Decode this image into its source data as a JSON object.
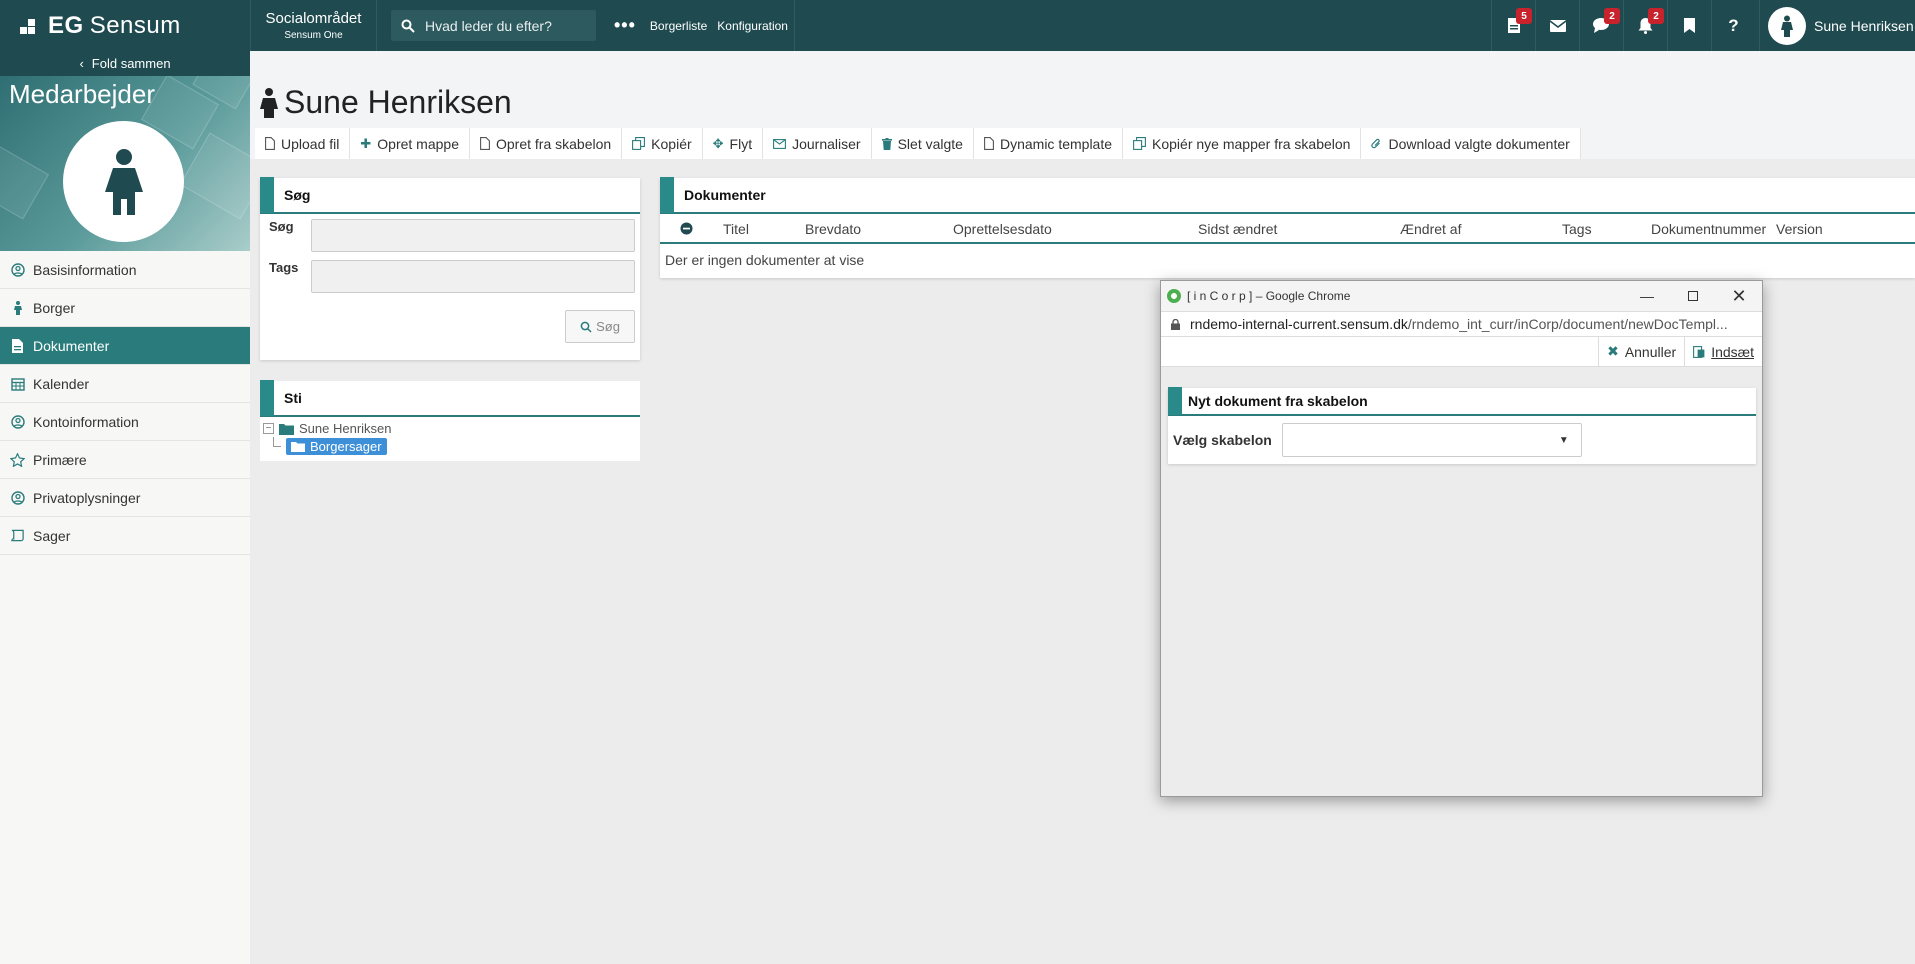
{
  "topbar": {
    "logo_prefix": "EG",
    "logo_name": "Sensum",
    "org_name": "Socialområdet",
    "org_sub": "Sensum One",
    "search_placeholder": "Hvad leder du efter?",
    "more_label": "•••",
    "links": [
      "Borgerliste",
      "Konfiguration"
    ],
    "icons": [
      {
        "name": "document-icon",
        "badge": "5"
      },
      {
        "name": "mail-icon",
        "badge": ""
      },
      {
        "name": "chat-icon",
        "badge": "2"
      },
      {
        "name": "bell-icon",
        "badge": "2"
      },
      {
        "name": "bookmark-icon",
        "badge": ""
      },
      {
        "name": "help-icon",
        "badge": ""
      }
    ],
    "user_name": "Sune Henriksen"
  },
  "sidebar": {
    "fold_label": "Fold sammen",
    "hero_title": "Medarbejder",
    "items": [
      {
        "label": "Basisinformation",
        "icon": "user-circle-icon"
      },
      {
        "label": "Borger",
        "icon": "person-icon"
      },
      {
        "label": "Dokumenter",
        "icon": "document-icon",
        "active": true
      },
      {
        "label": "Kalender",
        "icon": "calendar-icon"
      },
      {
        "label": "Kontoinformation",
        "icon": "user-circle-icon"
      },
      {
        "label": "Primære",
        "icon": "star-icon"
      },
      {
        "label": "Privatoplysninger",
        "icon": "user-circle-icon"
      },
      {
        "label": "Sager",
        "icon": "scroll-icon"
      }
    ]
  },
  "page": {
    "title": "Sune Henriksen",
    "toolbar": [
      {
        "label": "Upload fil",
        "icon": "file-icon"
      },
      {
        "label": "Opret mappe",
        "icon": "plus-icon"
      },
      {
        "label": "Opret fra skabelon",
        "icon": "file-icon"
      },
      {
        "label": "Kopiér",
        "icon": "copy-icon"
      },
      {
        "label": "Flyt",
        "icon": "move-icon"
      },
      {
        "label": "Journaliser",
        "icon": "envelope-icon"
      },
      {
        "label": "Slet valgte",
        "icon": "trash-icon"
      },
      {
        "label": "Dynamic template",
        "icon": "file-icon"
      },
      {
        "label": "Kopiér nye mapper fra skabelon",
        "icon": "copy-icon"
      },
      {
        "label": "Download valgte dokumenter",
        "icon": "paperclip-icon"
      }
    ]
  },
  "search_panel": {
    "title": "Søg",
    "search_label": "Søg",
    "tags_label": "Tags",
    "button_label": "Søg"
  },
  "sti_panel": {
    "title": "Sti",
    "root": "Sune Henriksen",
    "child": "Borgersager"
  },
  "documents": {
    "title": "Dokumenter",
    "columns": [
      "Titel",
      "Brevdato",
      "Oprettelsesdato",
      "Sidst ændret",
      "Ændret af",
      "Tags",
      "Dokumentnummer",
      "Version"
    ],
    "empty_text": "Der er ingen dokumenter at vise"
  },
  "popup": {
    "window_title": "[ i n C o r p ] – Google Chrome",
    "url_host": "rndemo-internal-current.sensum.dk",
    "url_path": "/rndemo_int_curr/inCorp/document/newDocTempl...",
    "cancel_label": "Annuller",
    "insert_label": "Indsæt",
    "panel_title": "Nyt dokument fra skabelon",
    "select_label": "Vælg skabelon",
    "select_value": ""
  },
  "colors": {
    "topbar": "#1f4a4f",
    "accent": "#2a7c7c",
    "badge": "#c8232c",
    "tree_selected": "#3d8fd8"
  }
}
